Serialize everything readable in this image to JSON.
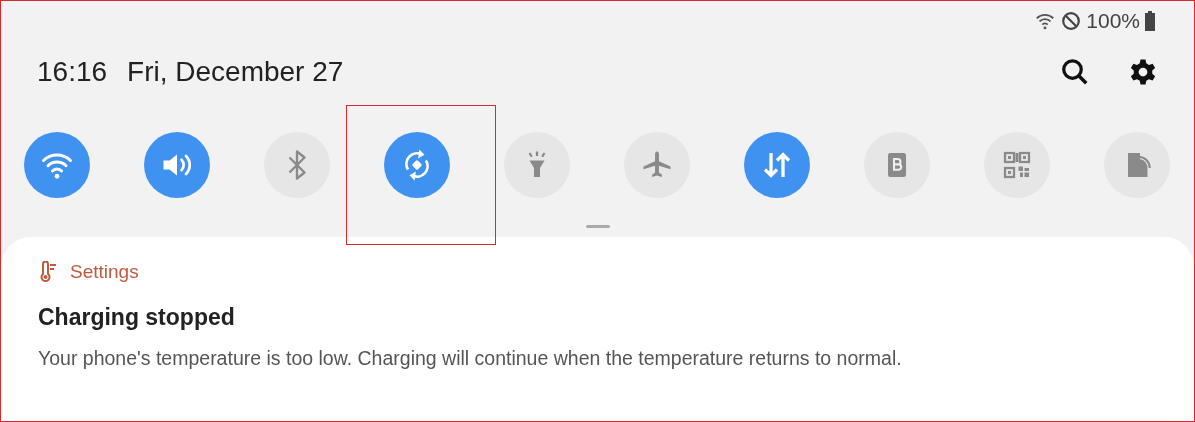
{
  "status_bar": {
    "battery_text": "100%"
  },
  "header": {
    "time": "16:16",
    "date": "Fri, December 27"
  },
  "quick_tiles": [
    {
      "kind": "wifi",
      "on": true,
      "highlighted": false
    },
    {
      "kind": "sound",
      "on": true,
      "highlighted": false
    },
    {
      "kind": "bluetooth",
      "on": false,
      "highlighted": false
    },
    {
      "kind": "rotate",
      "on": true,
      "highlighted": true
    },
    {
      "kind": "flashlight",
      "on": false,
      "highlighted": false
    },
    {
      "kind": "airplane",
      "on": false,
      "highlighted": false
    },
    {
      "kind": "data",
      "on": true,
      "highlighted": false
    },
    {
      "kind": "bixby",
      "on": false,
      "highlighted": false
    },
    {
      "kind": "qr",
      "on": false,
      "highlighted": false
    },
    {
      "kind": "cast",
      "on": false,
      "highlighted": false
    }
  ],
  "notification": {
    "app": "Settings",
    "title": "Charging stopped",
    "body": "Your phone's temperature is too low. Charging will continue when the temperature returns to normal."
  }
}
